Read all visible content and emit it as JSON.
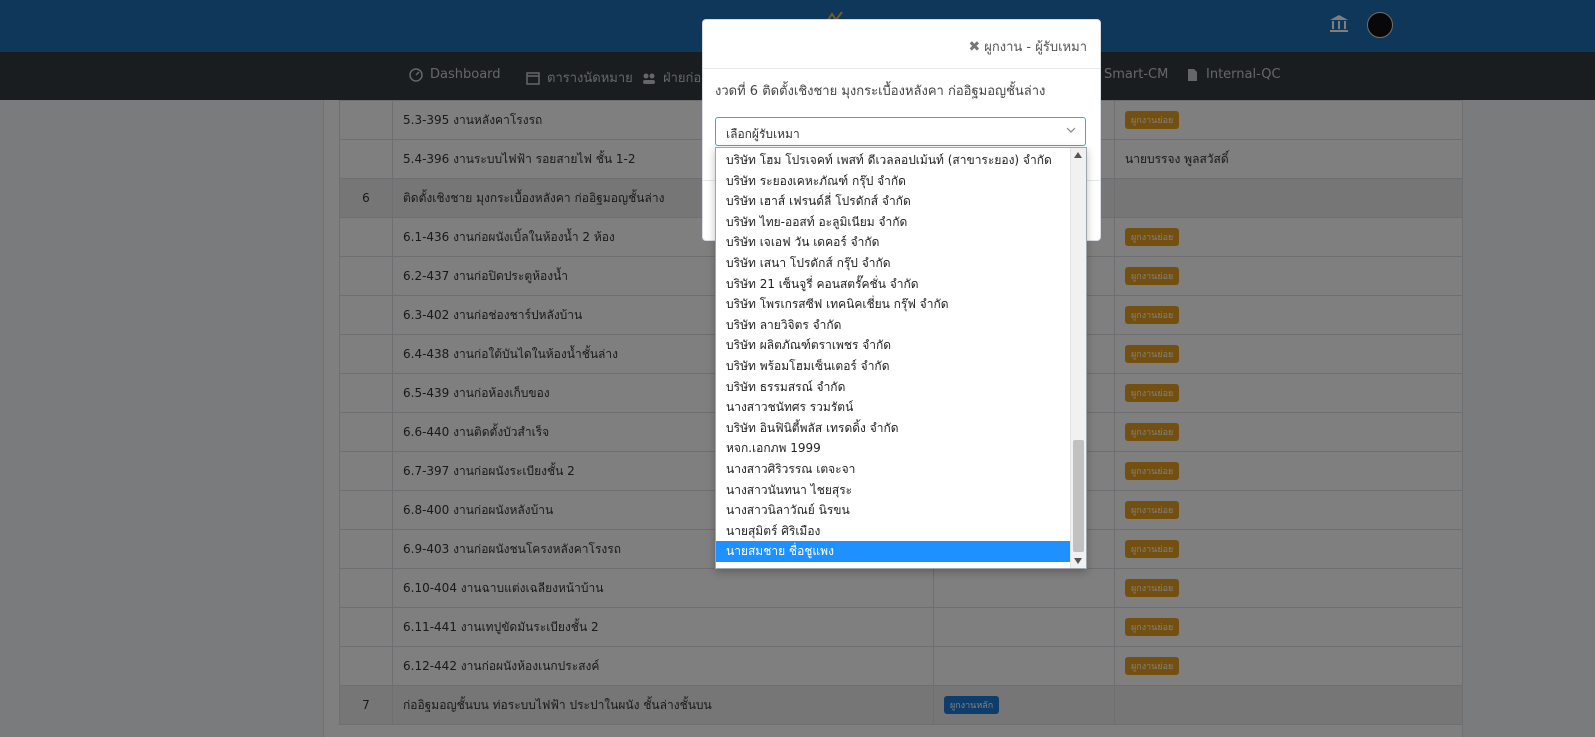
{
  "colors": {
    "topbar": "#1f6fb4",
    "navbar": "#343a40",
    "badge_orange": "#e6a11f",
    "badge_blue": "#1f7bd6",
    "select_highlight": "#1e90ff",
    "modal_danger": "#dc3545"
  },
  "nav": {
    "items": [
      {
        "label": "Dashboard",
        "icon": "dashboard-icon"
      },
      {
        "label": "ตารางนัดหมาย",
        "icon": "calendar-icon"
      },
      {
        "label": "ฝ่ายก่อ",
        "icon": "group-icon"
      },
      {
        "label": "Smart-CM",
        "icon": "document-icon"
      },
      {
        "label": "Internal-QC",
        "icon": "file-icon"
      }
    ]
  },
  "table": {
    "rows": [
      {
        "type": "item",
        "num": "",
        "name": "5.3-395  งานหลังคาโรงรถ",
        "badge": "ผูกงานย่อย",
        "contractor": ""
      },
      {
        "type": "item",
        "num": "",
        "name": "5.4-396  งานระบบไฟฟ้า รอยสายไฟ ชั้น 1-2",
        "badge": "",
        "contractor": "นายบรรจง พูลสวัสดิ์"
      },
      {
        "type": "group",
        "num": "6",
        "name": "ติดตั้งเชิงชาย มุงกระเบื้องหลังคา ก่ออิฐมอญชั้นล่าง",
        "badge": "",
        "contractor": ""
      },
      {
        "type": "item",
        "num": "",
        "name": "6.1-436  งานก่อผนังเบิ้ลในห้องน้ำ 2 ห้อง",
        "badge": "ผูกงานย่อย",
        "contractor": ""
      },
      {
        "type": "item",
        "num": "",
        "name": "6.2-437  งานก่อปิดประตูห้องน้ำ",
        "badge": "ผูกงานย่อย",
        "contractor": ""
      },
      {
        "type": "item",
        "num": "",
        "name": "6.3-402  งานก่อช่องชาร์ปหลังบ้าน",
        "badge": "ผูกงานย่อย",
        "contractor": ""
      },
      {
        "type": "item",
        "num": "",
        "name": "6.4-438  งานก่อใต้บันไดในห้องน้ำชั้นล่าง",
        "badge": "ผูกงานย่อย",
        "contractor": ""
      },
      {
        "type": "item",
        "num": "",
        "name": "6.5-439  งานก่อห้องเก็บของ",
        "badge": "ผูกงานย่อย",
        "contractor": ""
      },
      {
        "type": "item",
        "num": "",
        "name": "6.6-440  งานติดตั้งบัวสำเร็จ",
        "badge": "ผูกงานย่อย",
        "contractor": ""
      },
      {
        "type": "item",
        "num": "",
        "name": "6.7-397  งานก่อผนังระเบียงชั้น 2",
        "badge": "ผูกงานย่อย",
        "contractor": ""
      },
      {
        "type": "item",
        "num": "",
        "name": "6.8-400  งานก่อผนังหลังบ้าน",
        "badge": "ผูกงานย่อย",
        "contractor": ""
      },
      {
        "type": "item",
        "num": "",
        "name": "6.9-403  งานก่อผนังชนโครงหลังคาโรงรถ",
        "badge": "ผูกงานย่อย",
        "contractor": ""
      },
      {
        "type": "item",
        "num": "",
        "name": "6.10-404  งานฉาบแต่งเฉลียงหน้าบ้าน",
        "badge": "ผูกงานย่อย",
        "contractor": ""
      },
      {
        "type": "item",
        "num": "",
        "name": "6.11-441  งานเทปูขัดมันระเบียงชั้น 2",
        "badge": "ผูกงานย่อย",
        "contractor": ""
      },
      {
        "type": "item",
        "num": "",
        "name": "6.12-442  งานก่อผนังห้องเนกประสงค์",
        "badge": "ผูกงานย่อย",
        "contractor": ""
      },
      {
        "type": "group",
        "num": "7",
        "name": "ก่ออิฐมอญชั้นบน ท่อระบบไฟฟ้า ประปาในผนัง ชั้นล่างชั้นบน",
        "badge_main": "ผูกงานหลัก",
        "contractor": ""
      }
    ]
  },
  "modal": {
    "title": "ผูกงาน - ผู้รับเหมา",
    "subtitle": "งวดที่ 6 ติดตั้งเชิงชาย มุงกระเบื้องหลังคา ก่ออิฐมอญชั้นล่าง",
    "select_value": "เลือกผู้รับเหมา"
  },
  "dropdown": {
    "options": [
      "บริษัท โฮม โปรเจคท์ เพสท์ ดีเวลลอปเม้นท์ (สาขาระยอง) จำกัด",
      "บริษัท ระยองเคหะภัณฑ์ กรุ๊ป จำกัด",
      "บริษัท เฮาส์ เฟรนด์ลี่ โปรดักส์ จำกัด",
      "บริษัท ไทย-ออสท์ อะลูมิเนียม จำกัด",
      "บริษัท เจเอฟ วัน เดคอร์ จำกัด",
      "บริษัท เสนา โปรดักส์ กรุ๊ป จำกัด",
      "บริษัท 21 เซ็นจูรี่ คอนสตรั๊คชั่น จำกัด",
      "บริษัท โพรเกรสซีฟ เทคนิคเชี่ยน กรุ๊ฟ จำกัด",
      "บริษัท ลายวิจิตร จำกัด",
      "บริษัท ผลิตภัณฑ์ตราเพชร จำกัด",
      "บริษัท พร้อมโฮมเซ็นเตอร์ จำกัด",
      "บริษัท ธรรมสรณ์ จำกัด",
      "นางสาวชนัทศร รวมรัตน์",
      "บริษัท อินฟินิตี้พลัส เทรดดิ้ง จำกัด",
      "หจก.เอกภพ 1999",
      "นางสาวศิริวรรณ เตจะจา",
      "นางสาวนันทนา ไชยสุระ",
      "นางสาวนิลาวัณย์ นิรขน",
      "นายสุมิตร์ ศิริเมือง",
      "นายสมชาย ชื่อชูแพง"
    ],
    "selected_index": 19
  }
}
